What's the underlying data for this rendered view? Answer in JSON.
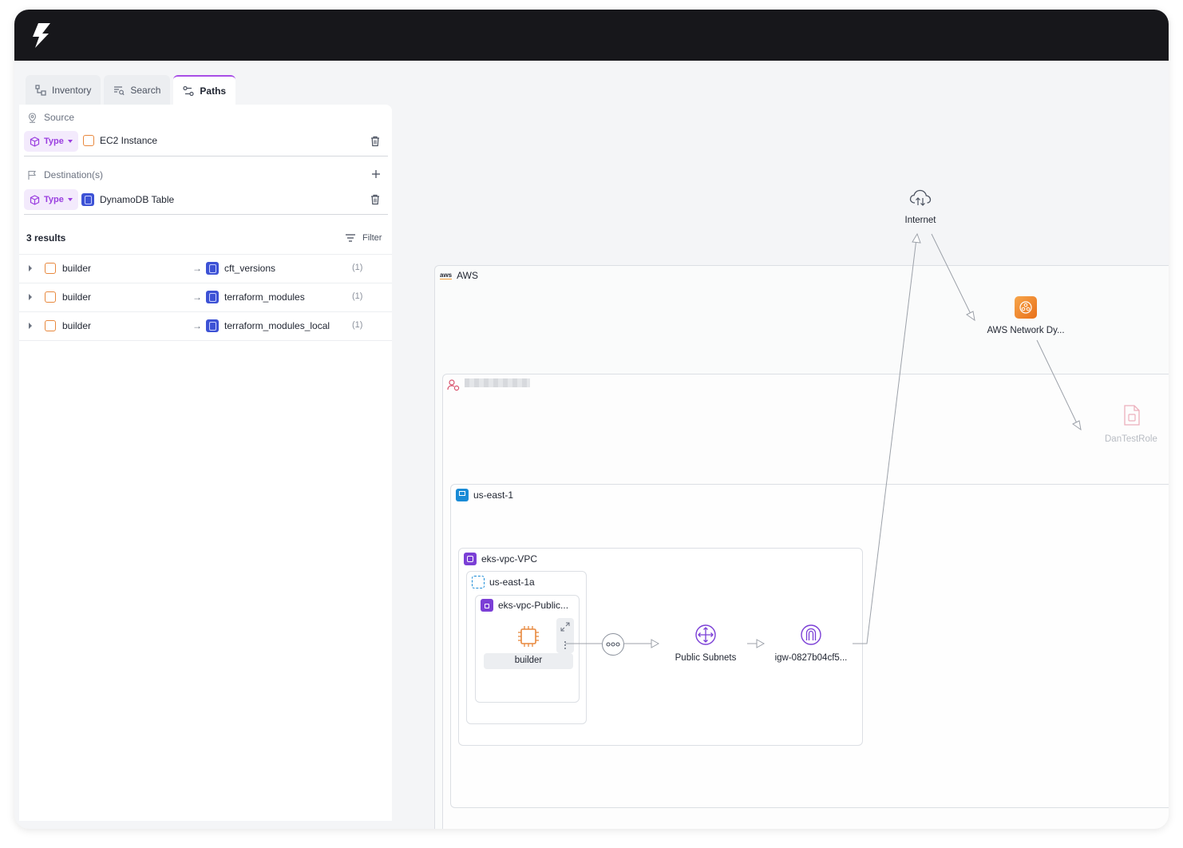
{
  "tabs": [
    {
      "label": "Inventory",
      "icon": "inventory-icon"
    },
    {
      "label": "Search",
      "icon": "search-icon"
    },
    {
      "label": "Paths",
      "icon": "paths-icon",
      "active": true
    }
  ],
  "source": {
    "label": "Source",
    "type_chip": "Type",
    "value": "EC2 Instance"
  },
  "destination": {
    "label": "Destination(s)",
    "type_chip": "Type",
    "value": "DynamoDB Table"
  },
  "results": {
    "count_label": "3 results",
    "filter_label": "Filter",
    "rows": [
      {
        "source": "builder",
        "target": "cft_versions",
        "count": "(1)"
      },
      {
        "source": "builder",
        "target": "terraform_modules",
        "count": "(1)"
      },
      {
        "source": "builder",
        "target": "terraform_modules_local",
        "count": "(1)"
      }
    ]
  },
  "graph": {
    "internet": "Internet",
    "aws": "AWS",
    "aws_badge": "aws",
    "network_node": "AWS Network Dy...",
    "role_node": "DanTestRole",
    "region": "us-east-1",
    "vpc": "eks-vpc-VPC",
    "az": "us-east-1a",
    "subnet": "eks-vpc-Public...",
    "instance": "builder",
    "public_subnets": "Public Subnets",
    "igw": "igw-0827b04cf5..."
  },
  "colors": {
    "accent": "#a84ee6",
    "topbar": "#17171b",
    "ec2": "#e8883d",
    "dynamodb": "#3d52d5",
    "vpc": "#7b3fd6",
    "region": "#1a8bd6"
  }
}
